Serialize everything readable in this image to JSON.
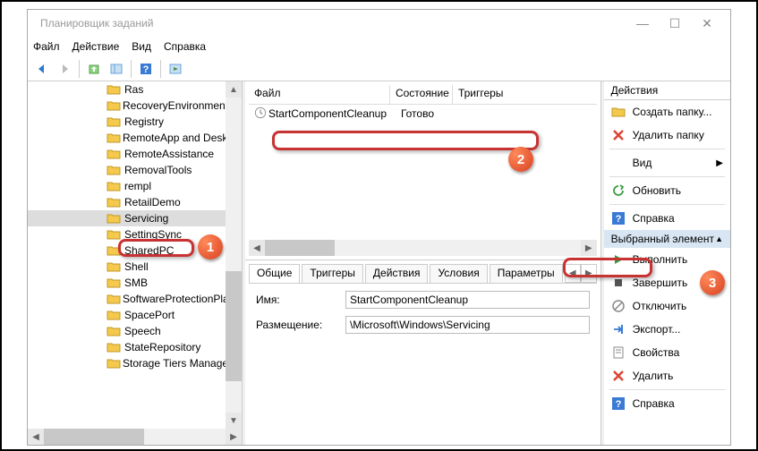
{
  "window": {
    "title": "Планировщик заданий"
  },
  "menu": {
    "file": "Файл",
    "action": "Действие",
    "view": "Вид",
    "help": "Справка"
  },
  "tree": {
    "items": [
      "Ras",
      "RecoveryEnvironment",
      "Registry",
      "RemoteApp and Desktop",
      "RemoteAssistance",
      "RemovalTools",
      "rempl",
      "RetailDemo",
      "Servicing",
      "SettingSync",
      "SharedPC",
      "Shell",
      "SMB",
      "SoftwareProtectionPlatform",
      "SpacePort",
      "Speech",
      "StateRepository",
      "Storage Tiers Management"
    ],
    "selected": 8
  },
  "tasklist": {
    "columns": {
      "name": "Файл",
      "state": "Состояние",
      "trig": "Триггеры"
    },
    "rows": [
      {
        "name": "StartComponentCleanup",
        "state": "Готово"
      }
    ]
  },
  "details": {
    "tabs": {
      "general": "Общие",
      "triggers": "Триггеры",
      "actions": "Действия",
      "conditions": "Условия",
      "params": "Параметры"
    },
    "name_label": "Имя:",
    "name_value": "StartComponentCleanup",
    "loc_label": "Размещение:",
    "loc_value": "\\Microsoft\\Windows\\Servicing"
  },
  "actions": {
    "title": "Действия",
    "top": {
      "create_folder": "Создать папку...",
      "delete_folder": "Удалить папку",
      "view": "Вид",
      "refresh": "Обновить",
      "help": "Справка"
    },
    "section": "Выбранный элемент",
    "sel": {
      "run": "Выполнить",
      "end": "Завершить",
      "disable": "Отключить",
      "export": "Экспорт...",
      "props": "Свойства",
      "delete": "Удалить",
      "help": "Справка"
    }
  },
  "callout": {
    "b1": "1",
    "b2": "2",
    "b3": "3"
  }
}
